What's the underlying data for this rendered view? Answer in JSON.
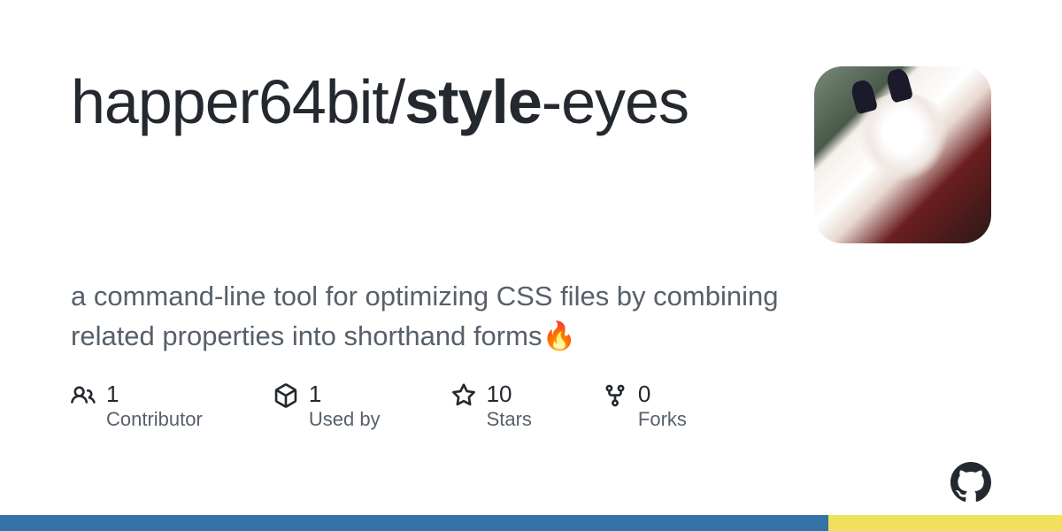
{
  "repo": {
    "owner": "happer64bit",
    "name_bold": "style",
    "name_rest": "-eyes"
  },
  "description": "a command-line tool for optimizing CSS files by combining related properties into shorthand forms🔥",
  "stats": {
    "contributors": {
      "value": "1",
      "label": "Contributor"
    },
    "used_by": {
      "value": "1",
      "label": "Used by"
    },
    "stars": {
      "value": "10",
      "label": "Stars"
    },
    "forks": {
      "value": "0",
      "label": "Forks"
    }
  },
  "languages": {
    "primary_pct": "78",
    "secondary_pct": "22"
  }
}
